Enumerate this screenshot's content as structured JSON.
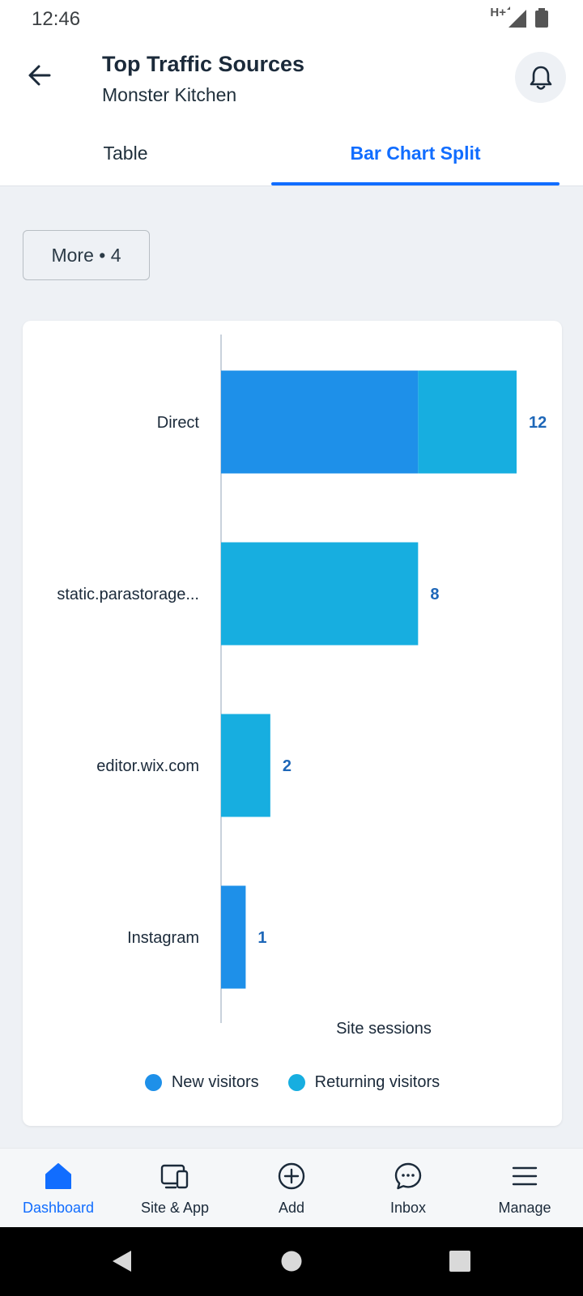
{
  "status_bar": {
    "time": "12:46",
    "network": "H+",
    "icons": [
      "signal-icon",
      "battery-icon"
    ]
  },
  "header": {
    "back_icon": "arrow-left-icon",
    "title": "Top Traffic Sources",
    "subtitle": "Monster Kitchen",
    "bell_icon": "bell-icon"
  },
  "tabs": [
    {
      "label": "Table",
      "active": false
    },
    {
      "label": "Bar Chart Split",
      "active": true
    }
  ],
  "more_button": {
    "label": "More • 4"
  },
  "chart_data": {
    "type": "bar",
    "orientation": "horizontal",
    "stacked": true,
    "categories": [
      "Direct",
      "static.parastorage...",
      "editor.wix.com",
      "Instagram"
    ],
    "series": [
      {
        "name": "New visitors",
        "color": "#1e90e9",
        "values": [
          8,
          0,
          0,
          1
        ]
      },
      {
        "name": "Returning visitors",
        "color": "#17aee0",
        "values": [
          4,
          8,
          2,
          0
        ]
      }
    ],
    "totals": [
      12,
      8,
      2,
      1
    ],
    "xlabel": "Site sessions",
    "xlim": [
      0,
      12
    ],
    "legend_position": "bottom",
    "grid": false
  },
  "colors": {
    "accent": "#116dff",
    "new_visitors": "#1e90e9",
    "returning_visitors": "#17aee0",
    "value_label": "#1e67b8"
  },
  "bottom_nav": {
    "items": [
      {
        "label": "Dashboard",
        "icon": "home-icon",
        "active": true
      },
      {
        "label": "Site & App",
        "icon": "devices-icon",
        "active": false
      },
      {
        "label": "Add",
        "icon": "plus-circle-icon",
        "active": false
      },
      {
        "label": "Inbox",
        "icon": "chat-icon",
        "active": false
      },
      {
        "label": "Manage",
        "icon": "menu-icon",
        "active": false
      }
    ]
  },
  "system_nav": {
    "icons": [
      "back-triangle-icon",
      "home-circle-icon",
      "recents-square-icon"
    ]
  }
}
